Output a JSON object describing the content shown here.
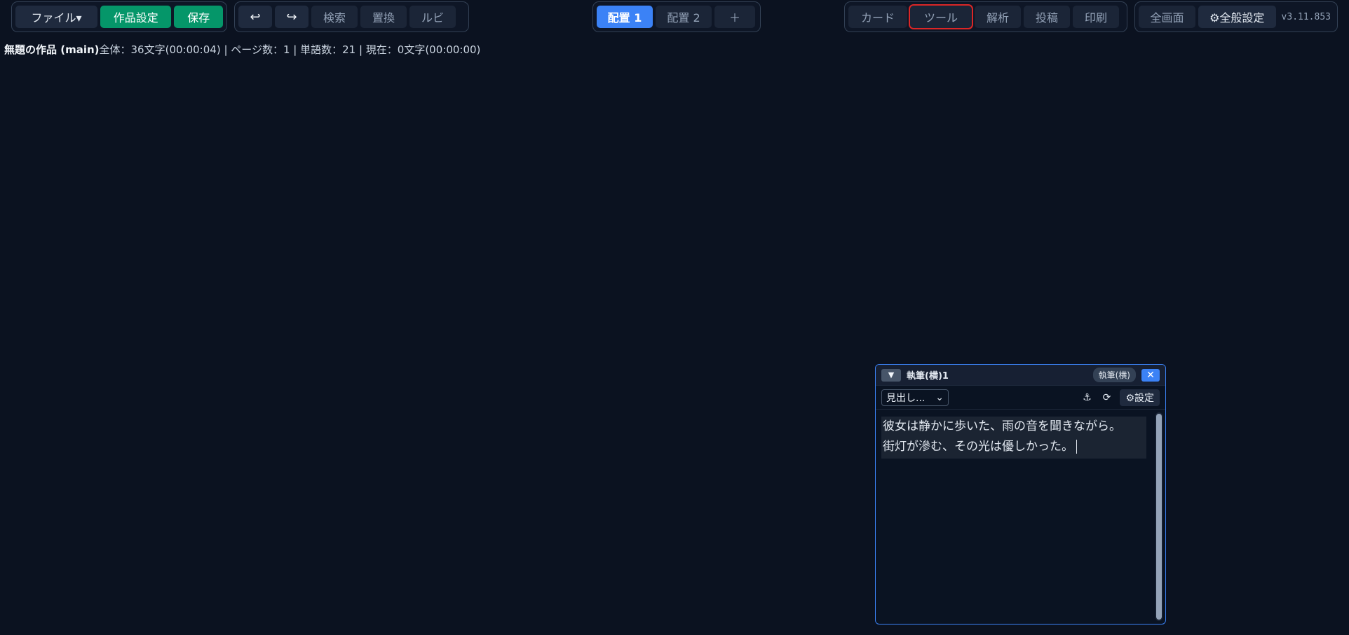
{
  "toolbar": {
    "file_label": "ファイル▾",
    "work_settings_label": "作品設定",
    "save_label": "保存",
    "undo_icon": "undo-icon",
    "undo_glyph": "↩",
    "redo_icon": "redo-icon",
    "redo_glyph": "↪",
    "search_label": "検索",
    "replace_label": "置換",
    "ruby_label": "ルビ",
    "layouts": [
      "配置 1",
      "配置 2"
    ],
    "add_layout_glyph": "＋",
    "card_label": "カード",
    "tool_label": "ツール",
    "analysis_label": "解析",
    "post_label": "投稿",
    "print_label": "印刷",
    "fullscreen_label": "全画面",
    "general_settings_label": "⚙全般設定",
    "version": "v3.11.853"
  },
  "status": {
    "title": "無題の作品 (main)",
    "stats": "全体：36文字(00:00:04) | ページ数：1 | 単語数：21 | 現在：0文字(00:00:00)"
  },
  "panel": {
    "collapse_glyph": "▼",
    "title": "執筆(横)1",
    "badge": "執筆(横)",
    "close_glyph": "✕",
    "heading_select": "見出し...",
    "heading_chevron": "⌄",
    "anchor_glyph": "⚓",
    "refresh_glyph": "⟳",
    "settings_label": "⚙設定",
    "text_lines": [
      "彼女は静かに歩いた、雨の音を聞きながら。",
      "街灯が滲む、その光は優しかった。"
    ]
  },
  "colors": {
    "background": "#0b1220",
    "accent": "#3b82f6",
    "save_green": "#059669",
    "highlight_red": "#dc2626"
  }
}
